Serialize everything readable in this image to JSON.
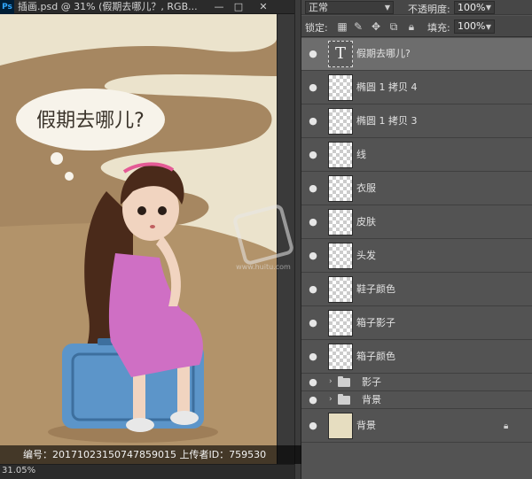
{
  "document": {
    "title": "插画.psd @ 31% (假期去哪儿？, RGB...",
    "app_logo": "Ps",
    "zoom": "31.05%",
    "bubble_text": "假期去哪儿?"
  },
  "window_controls": {
    "minimize": "—",
    "maximize": "□",
    "close": "✕"
  },
  "layers_panel": {
    "blend_mode": "正常",
    "opacity_label": "不透明度:",
    "opacity_value": "100%",
    "lock_label": "锁定:",
    "fill_label": "填充:",
    "fill_value": "100%",
    "layers": [
      {
        "name": "假期去哪儿?",
        "kind": "text",
        "selected": true
      },
      {
        "name": "椭圆 1 拷贝 4",
        "kind": "shape"
      },
      {
        "name": "椭圆 1 拷贝 3",
        "kind": "shape"
      },
      {
        "name": "线",
        "kind": "pixel"
      },
      {
        "name": "衣服",
        "kind": "pixel"
      },
      {
        "name": "皮肤",
        "kind": "pixel"
      },
      {
        "name": "头发",
        "kind": "pixel"
      },
      {
        "name": "鞋子颜色",
        "kind": "pixel"
      },
      {
        "name": "箱子影子",
        "kind": "pixel"
      },
      {
        "name": "箱子颜色",
        "kind": "pixel"
      },
      {
        "name": "影子",
        "kind": "group"
      },
      {
        "name": "背景",
        "kind": "group"
      },
      {
        "name": "背景",
        "kind": "background",
        "locked": true
      }
    ]
  },
  "caption": "编号：20171023150747859015 上传者ID：759530",
  "watermark_text": "www.huitu.com",
  "colors": {
    "panel_bg": "#535353",
    "selected_layer": "#6d6d6d",
    "canvas_bg": "#ebe3cc",
    "road": "#9c7b55",
    "dress": "#cf6fc4",
    "suitcase": "#5c95c9",
    "hair": "#4a2a1a"
  }
}
